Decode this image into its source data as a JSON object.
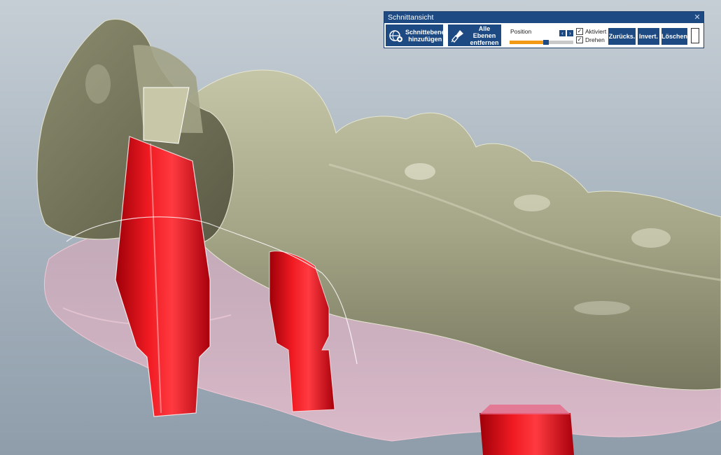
{
  "panel": {
    "title": "Schnittansicht",
    "close_icon": "close-icon",
    "add_plane_button": {
      "line1": "Schnittebene",
      "line2": "hinzufügen",
      "icon": "add-section-plane-icon"
    },
    "remove_planes_button": {
      "line1": "Alle Ebenen",
      "line2": "entfernen",
      "icon": "brush-remove-icon"
    },
    "position": {
      "label": "Position",
      "fill_fraction": 0.53,
      "thumb_fraction": 0.53,
      "left_icon": "chevron-left-icon",
      "right_icon": "chevron-right-icon"
    },
    "checkboxes": [
      {
        "label": "Aktiviert",
        "checked": true
      },
      {
        "label": "Drehen",
        "checked": true
      }
    ],
    "reset_button": "Zurücks.",
    "invert_button": "Invert.",
    "delete_button": "Löschen"
  },
  "colors": {
    "accent": "#1d4a82",
    "slider_fill": "#f29a16",
    "model_teeth": "#a7a78a",
    "implant": "#e0121a",
    "gingiva": "#e3aebf"
  }
}
